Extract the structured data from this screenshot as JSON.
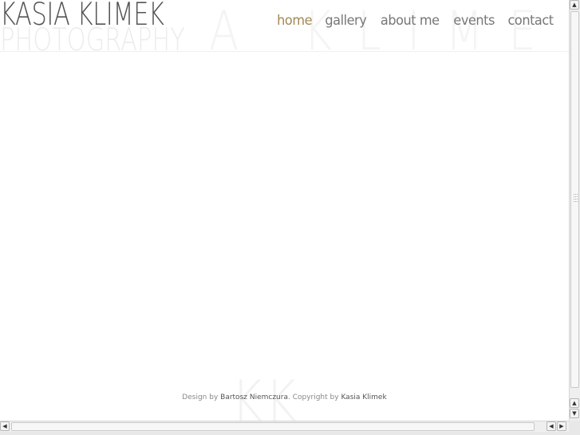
{
  "site": {
    "name": "KASIA KLIMEK",
    "subtitle": "PHOTOGRAPHY",
    "watermark": "A KLIMEK",
    "footer_mark": "KK"
  },
  "nav": {
    "items": [
      {
        "label": "home",
        "active": true
      },
      {
        "label": "gallery",
        "active": false
      },
      {
        "label": "about me",
        "active": false
      },
      {
        "label": "events",
        "active": false
      },
      {
        "label": "contact",
        "active": false
      }
    ],
    "active_color": "#a08a52",
    "color": "#777777"
  },
  "footer": {
    "design_by_prefix": "Design by ",
    "designer": "Bartosz Niemczura",
    "copyright_prefix": ". Copyright by ",
    "owner": "Kasia Klimek"
  }
}
